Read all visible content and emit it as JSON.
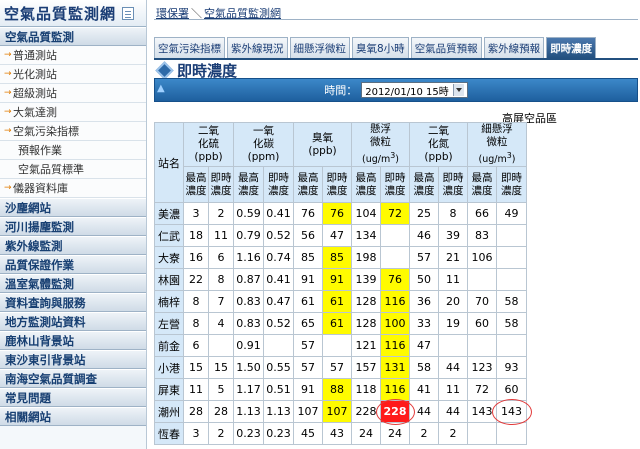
{
  "sidebar": {
    "title": "空氣品質監測網",
    "items": [
      {
        "type": "section",
        "label": "空氣品質監測"
      },
      {
        "type": "sub",
        "label": "普通測站"
      },
      {
        "type": "sub",
        "label": "光化測站"
      },
      {
        "type": "sub",
        "label": "超級測站"
      },
      {
        "type": "sub",
        "label": "大氣達測"
      },
      {
        "type": "sub",
        "label": "空氣污染指標"
      },
      {
        "type": "subindent",
        "label": "預報作業"
      },
      {
        "type": "subindent",
        "label": "空氣品質標準"
      },
      {
        "type": "sub",
        "label": "儀器資料庫"
      },
      {
        "type": "section",
        "label": "沙塵網站"
      },
      {
        "type": "section",
        "label": "河川揚塵監測"
      },
      {
        "type": "section",
        "label": "紫外線監測"
      },
      {
        "type": "section",
        "label": "品質保證作業"
      },
      {
        "type": "section",
        "label": "溫室氣體監測"
      },
      {
        "type": "section",
        "label": "資料查詢與服務"
      },
      {
        "type": "section",
        "label": "地方監測站資料"
      },
      {
        "type": "section",
        "label": "鹿林山背景站"
      },
      {
        "type": "section",
        "label": "東沙東引背景站"
      },
      {
        "type": "section",
        "label": "南海空氣品質調查"
      },
      {
        "type": "section",
        "label": "常見問題"
      },
      {
        "type": "section",
        "label": "相關網站"
      }
    ]
  },
  "breadcrumb": [
    "環保署",
    "空氣品質監測網"
  ],
  "tabs": [
    "空氣污染指標",
    "紫外線現況",
    "細懸浮微粒",
    "臭氧8小時",
    "空氣品質預報",
    "紫外線預報",
    "即時濃度"
  ],
  "active_tab": 6,
  "page_title": "即時濃度",
  "time_bar": {
    "label": "時間：",
    "selected": "2012/01/10 15時"
  },
  "high_screen_label": "高屏空品區",
  "table": {
    "station_header": "站名",
    "groups": [
      {
        "lines": [
          "二氧",
          "化硫",
          "(ppb)"
        ]
      },
      {
        "lines": [
          "一氧",
          "化碳",
          "(ppm)"
        ]
      },
      {
        "lines": [
          "臭氧",
          "(ppb)"
        ]
      },
      {
        "lines": [
          "懸浮",
          "微粒",
          "(ug/m3)"
        ]
      },
      {
        "lines": [
          "二氧",
          "化氮",
          "(ppb)"
        ]
      },
      {
        "lines": [
          "細懸浮",
          "微粒",
          "(ug/m3)"
        ]
      }
    ],
    "sub_headers": [
      "最高",
      "濃度",
      "即時",
      "濃度"
    ],
    "rows": [
      {
        "station": "美濃",
        "values": [
          "3",
          "2",
          "0.59",
          "0.41",
          "76",
          "76",
          "104",
          "72",
          "25",
          "8",
          "66",
          "49"
        ]
      },
      {
        "station": "仁武",
        "values": [
          "18",
          "11",
          "0.79",
          "0.52",
          "56",
          "47",
          "134",
          "",
          "46",
          "39",
          "83",
          ""
        ]
      },
      {
        "station": "大寮",
        "values": [
          "16",
          "6",
          "1.16",
          "0.74",
          "85",
          "85",
          "198",
          "",
          "57",
          "21",
          "106",
          ""
        ]
      },
      {
        "station": "林園",
        "values": [
          "22",
          "8",
          "0.87",
          "0.41",
          "91",
          "91",
          "139",
          "76",
          "50",
          "11",
          "",
          ""
        ]
      },
      {
        "station": "楠梓",
        "values": [
          "8",
          "7",
          "0.83",
          "0.47",
          "61",
          "61",
          "128",
          "116",
          "36",
          "20",
          "70",
          "58"
        ]
      },
      {
        "station": "左營",
        "values": [
          "8",
          "4",
          "0.83",
          "0.52",
          "65",
          "61",
          "128",
          "100",
          "33",
          "19",
          "60",
          "58"
        ]
      },
      {
        "station": "前金",
        "values": [
          "6",
          "",
          "0.91",
          "",
          "57",
          "",
          "121",
          "116",
          "47",
          "",
          "",
          ""
        ]
      },
      {
        "station": "小港",
        "values": [
          "15",
          "15",
          "1.50",
          "0.55",
          "57",
          "57",
          "157",
          "131",
          "58",
          "44",
          "123",
          "93"
        ]
      },
      {
        "station": "屏東",
        "values": [
          "11",
          "5",
          "1.17",
          "0.51",
          "91",
          "88",
          "118",
          "116",
          "41",
          "11",
          "72",
          "60"
        ]
      },
      {
        "station": "潮州",
        "values": [
          "28",
          "28",
          "1.13",
          "1.13",
          "107",
          "107",
          "228",
          "228",
          "44",
          "44",
          "143",
          "143"
        ]
      },
      {
        "station": "恆春",
        "values": [
          "3",
          "2",
          "0.23",
          "0.23",
          "45",
          "43",
          "24",
          "24",
          "2",
          "2",
          "",
          ""
        ]
      }
    ],
    "highlights": {
      "yellow": [
        [
          0,
          5
        ],
        [
          0,
          7
        ],
        [
          2,
          5
        ],
        [
          3,
          5
        ],
        [
          3,
          7
        ],
        [
          4,
          5
        ],
        [
          4,
          7
        ],
        [
          5,
          5
        ],
        [
          5,
          7
        ],
        [
          6,
          7
        ],
        [
          7,
          7
        ],
        [
          8,
          5
        ],
        [
          8,
          7
        ],
        [
          9,
          5
        ]
      ],
      "red": [
        [
          9,
          7
        ]
      ]
    },
    "colors": {
      "yellow": "#fffb00",
      "red": "#ff1a1a",
      "header_bg": "#d5e8f8",
      "nav_text": "#1a3d75",
      "tab_active": "#23507f"
    }
  }
}
